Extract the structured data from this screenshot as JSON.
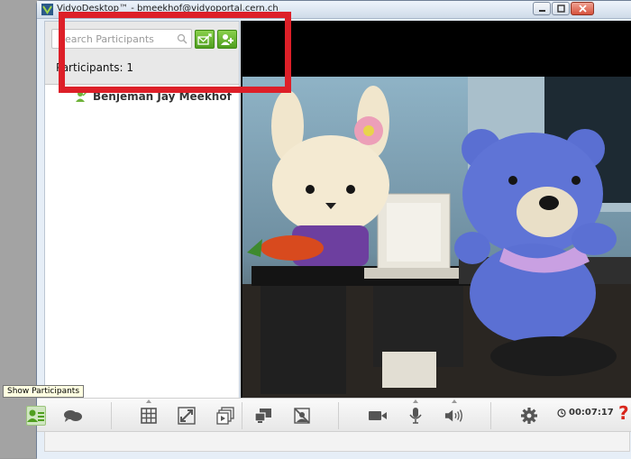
{
  "window": {
    "title": "VidyoDesktop™ - bmeekhof@vidyoportal.cern.ch"
  },
  "participants": {
    "search_placeholder": "Search Participants",
    "count_label": "Participants: 1",
    "items": [
      {
        "name": "Benjeman Jay Meekhof"
      }
    ]
  },
  "toolbar": {
    "buttons": [
      "participants-icon",
      "chat-icon",
      "layout-grid-icon",
      "fullscreen-icon",
      "share-icon",
      "self-view-icon",
      "privacy-icon",
      "camera-icon",
      "microphone-icon",
      "speaker-icon",
      "gear-icon"
    ],
    "timer": "00:07:17"
  },
  "tooltip": {
    "text": "Show Participants"
  },
  "colors": {
    "accent_green": "#5aa82a",
    "highlight_red": "#dd1f28"
  }
}
